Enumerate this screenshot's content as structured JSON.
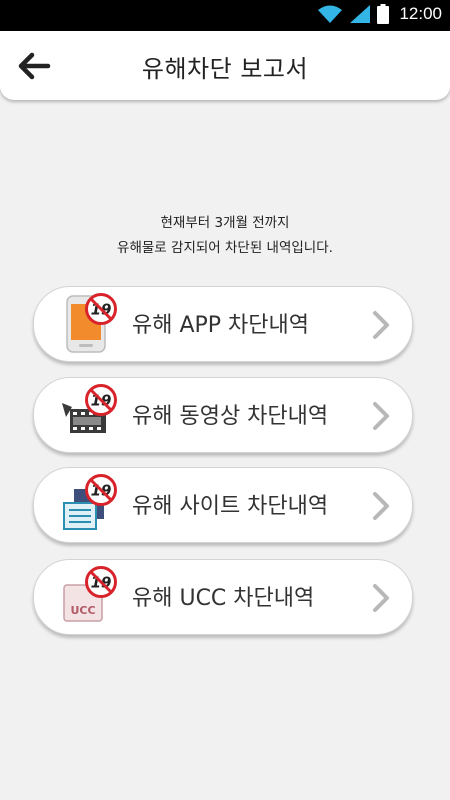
{
  "status_bar": {
    "time": "12:00",
    "icons": [
      "wifi-icon",
      "signal-icon",
      "battery-icon"
    ]
  },
  "header": {
    "title": "유해차단 보고서",
    "back_icon": "arrow-left-icon"
  },
  "description": {
    "line1": "현재부터 3개월 전까지",
    "line2": "유해물로 감지되어 차단된 내역입니다."
  },
  "menu": {
    "items": [
      {
        "label": "유해 APP 차단내역",
        "icon": "phone-app-icon"
      },
      {
        "label": "유해 동영상 차단내역",
        "icon": "film-icon"
      },
      {
        "label": "유해 사이트 차단내역",
        "icon": "document-icon"
      },
      {
        "label": "유해 UCC 차단내역",
        "icon": "ucc-icon"
      }
    ],
    "badge_text": "19"
  },
  "colors": {
    "accent_red": "#d9232b",
    "status_icon_teal": "#33b5e5",
    "background": "#f1f1f1"
  }
}
